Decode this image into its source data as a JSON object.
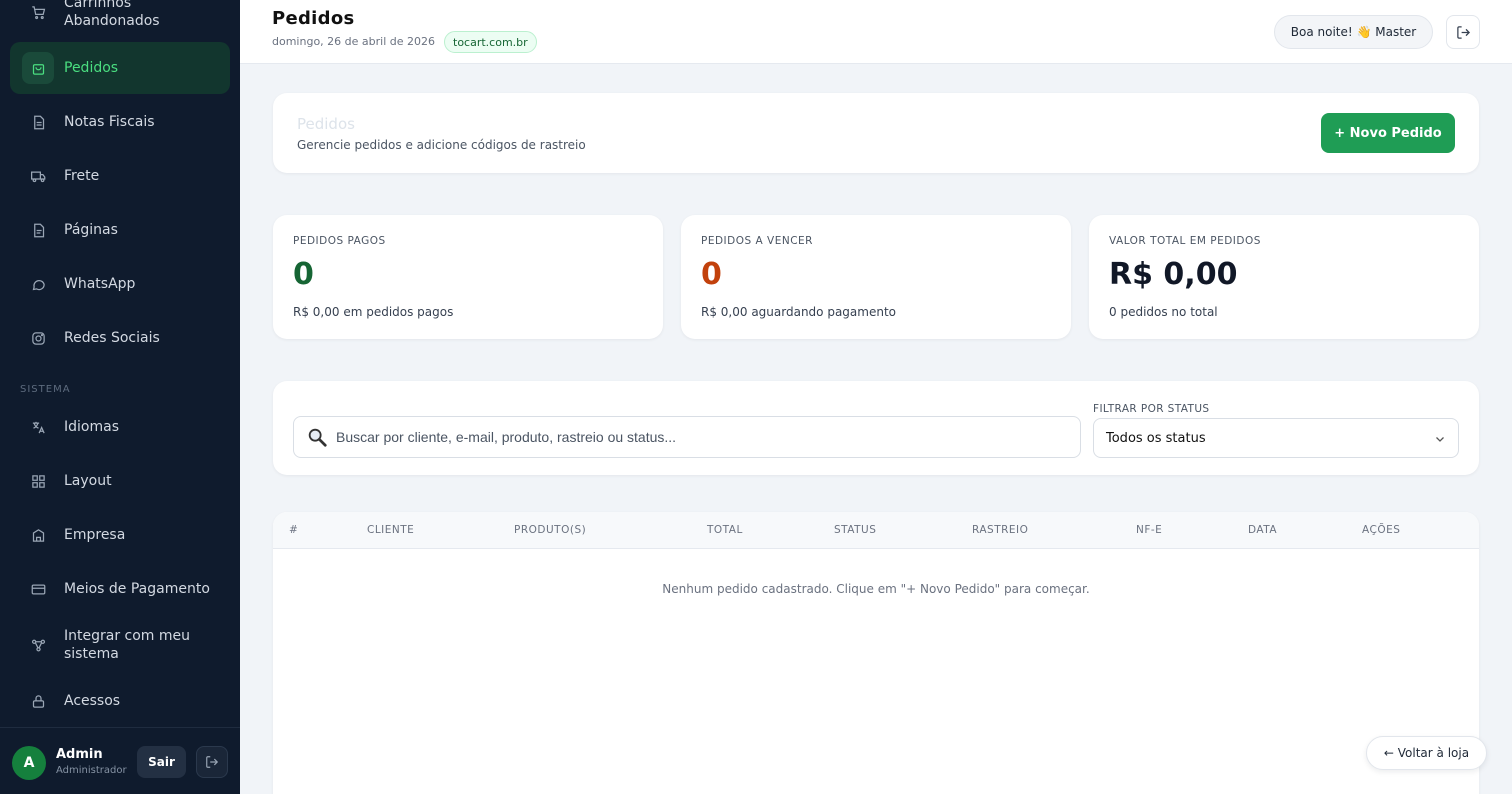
{
  "sidebar": {
    "items": [
      {
        "label": "Carrinhos Abandonados",
        "icon": "cart-icon"
      },
      {
        "label": "Pedidos",
        "icon": "bag-icon",
        "active": true
      },
      {
        "label": "Notas Fiscais",
        "icon": "document-icon"
      },
      {
        "label": "Frete",
        "icon": "truck-icon"
      },
      {
        "label": "Páginas",
        "icon": "page-icon"
      },
      {
        "label": "WhatsApp",
        "icon": "chat-icon"
      },
      {
        "label": "Redes Sociais",
        "icon": "instagram-icon"
      }
    ],
    "section_label": "SISTEMA",
    "system_items": [
      {
        "label": "Idiomas",
        "icon": "translate-icon"
      },
      {
        "label": "Layout",
        "icon": "layout-icon"
      },
      {
        "label": "Empresa",
        "icon": "building-icon"
      },
      {
        "label": "Meios de Pagamento",
        "icon": "credit-card-icon"
      },
      {
        "label": "Integrar com meu sistema",
        "icon": "integration-icon"
      },
      {
        "label": "Acessos",
        "icon": "lock-icon"
      }
    ],
    "user": {
      "initial": "A",
      "name": "Admin",
      "role": "Administrador",
      "logout_label": "Sair"
    }
  },
  "topbar": {
    "title": "Pedidos",
    "date": "domingo, 26 de abril de 2026",
    "domain": "tocart.com.br",
    "greeting": "Boa noite! 👋 Master"
  },
  "header_card": {
    "title": "Pedidos",
    "subtitle": "Gerencie pedidos e adicione códigos de rastreio",
    "new_button": "+ Novo Pedido"
  },
  "stats": [
    {
      "label": "PEDIDOS PAGOS",
      "value": "0",
      "sub": "R$ 0,00 em pedidos pagos",
      "color": "#166534"
    },
    {
      "label": "PEDIDOS A VENCER",
      "value": "0",
      "sub": "R$ 0,00 aguardando pagamento",
      "color": "#c2410c"
    },
    {
      "label": "VALOR TOTAL EM PEDIDOS",
      "value": "R$ 0,00",
      "sub": "0 pedidos no total",
      "color": "#111827"
    }
  ],
  "filters": {
    "search_placeholder": "Buscar por cliente, e-mail, produto, rastreio ou status...",
    "status_label": "FILTRAR POR STATUS",
    "status_value": "Todos os status"
  },
  "table": {
    "columns": [
      "#",
      "CLIENTE",
      "PRODUTO(S)",
      "TOTAL",
      "STATUS",
      "RASTREIO",
      "NF-E",
      "DATA",
      "AÇÕES"
    ],
    "empty_message": "Nenhum pedido cadastrado. Clique em \"+ Novo Pedido\" para começar."
  },
  "back_button": "← Voltar à loja",
  "colors": {
    "sidebar_bg": "#0f1b2d",
    "accent_green": "#1f9d55",
    "active_text": "#4ade80"
  }
}
